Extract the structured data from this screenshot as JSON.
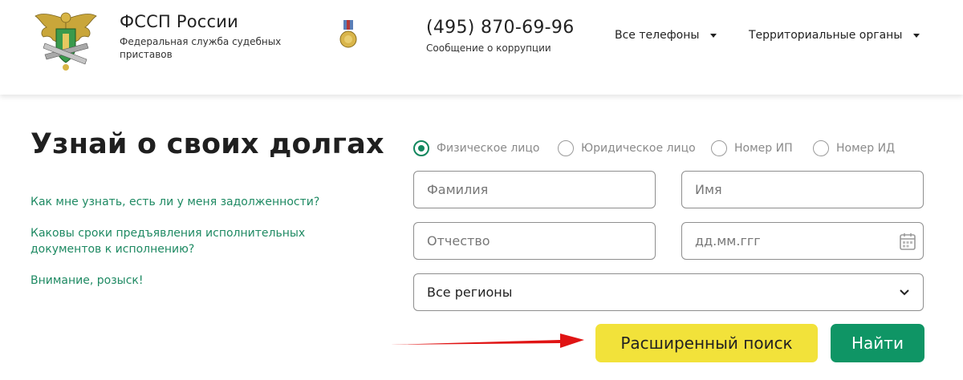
{
  "header": {
    "org_title": "ФССП России",
    "org_subtitle": "Федеральная служба судебных приставов",
    "phone": "(495) 870-69-96",
    "phone_caption": "Сообщение о коррупции",
    "nav": [
      {
        "label": "Все телефоны"
      },
      {
        "label": "Территориальные органы"
      }
    ]
  },
  "main": {
    "title": "Узнай о своих долгах",
    "faq_links": [
      {
        "label": "Как мне узнать, есть ли у меня задолженности?"
      },
      {
        "label": "Каковы сроки предъявления исполнительных документов к исполнению?"
      },
      {
        "label": "Внимание, розыск!"
      }
    ]
  },
  "search": {
    "radios": [
      {
        "label": "Физическое лицо",
        "checked": true
      },
      {
        "label": "Юридическое лицо",
        "checked": false
      },
      {
        "label": "Номер ИП",
        "checked": false
      },
      {
        "label": "Номер ИД",
        "checked": false
      }
    ],
    "lastname_placeholder": "Фамилия",
    "firstname_placeholder": "Имя",
    "middlename_placeholder": "Отчество",
    "date_placeholder": "дд.мм.ггг",
    "region_selected": "Все регионы",
    "advanced_label": "Расширенный поиск",
    "find_label": "Найти"
  },
  "colors": {
    "accent_green": "#0f9565",
    "link_green": "#1f8a63",
    "advanced_yellow": "#f2e23a",
    "arrow_red": "#e01414"
  }
}
